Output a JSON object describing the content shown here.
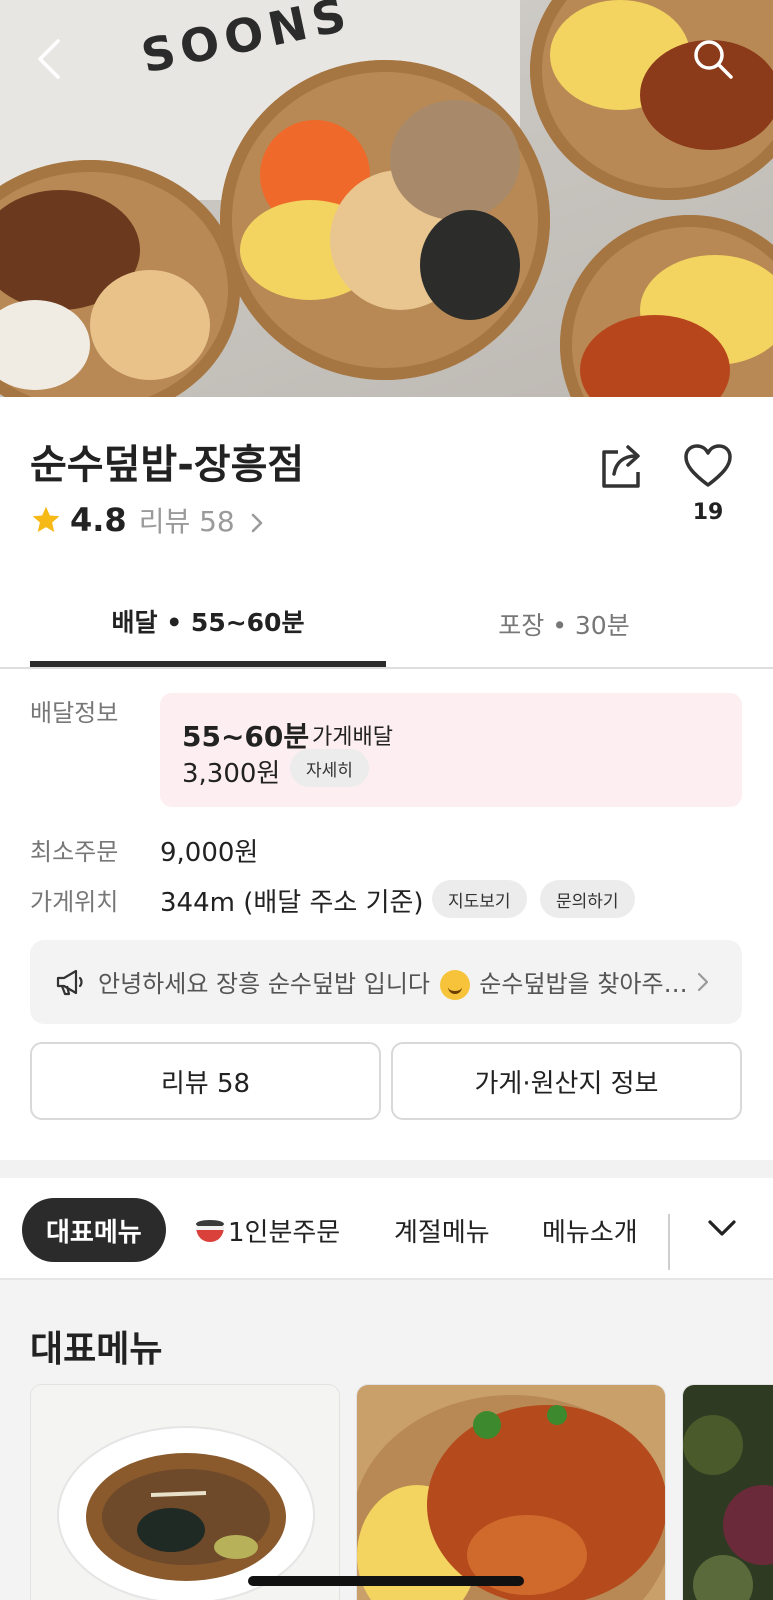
{
  "hero": {
    "bag_text": "SOONS"
  },
  "store": {
    "name": "순수덮밥-장흥점",
    "rating": "4.8",
    "review_link": "리뷰 58",
    "like_count": "19"
  },
  "tabs": [
    {
      "label": "배달 • 55~60분",
      "active": true
    },
    {
      "label": "포장 • 30분",
      "active": false
    }
  ],
  "delivery": {
    "label": "배달정보",
    "time": "55~60분",
    "type": "가게배달",
    "fee": "3,300원",
    "detail_button": "자세히"
  },
  "min_order": {
    "label": "최소주문",
    "value": "9,000원"
  },
  "location": {
    "label": "가게위치",
    "value": "344m (배달 주소 기준)",
    "map_button": "지도보기",
    "inquiry_button": "문의하기"
  },
  "notice": {
    "text_before": "안녕하세요 장흥 순수덮밥 입니다",
    "text_after": "순수덮밥을 찾아주…"
  },
  "buttons": {
    "reviews": "리뷰 58",
    "store_origin": "가게·원산지 정보"
  },
  "menu_tabs": [
    {
      "label": "대표메뉴",
      "active": true
    },
    {
      "label": "1인분주문",
      "active": false
    },
    {
      "label": "계절메뉴",
      "active": false
    },
    {
      "label": "메뉴소개",
      "active": false
    }
  ],
  "menu_section": {
    "title": "대표메뉴"
  },
  "colors": {
    "accent_dark": "#2b2b2b",
    "delivery_box": "#fdeff1",
    "star": "#f6b916"
  }
}
